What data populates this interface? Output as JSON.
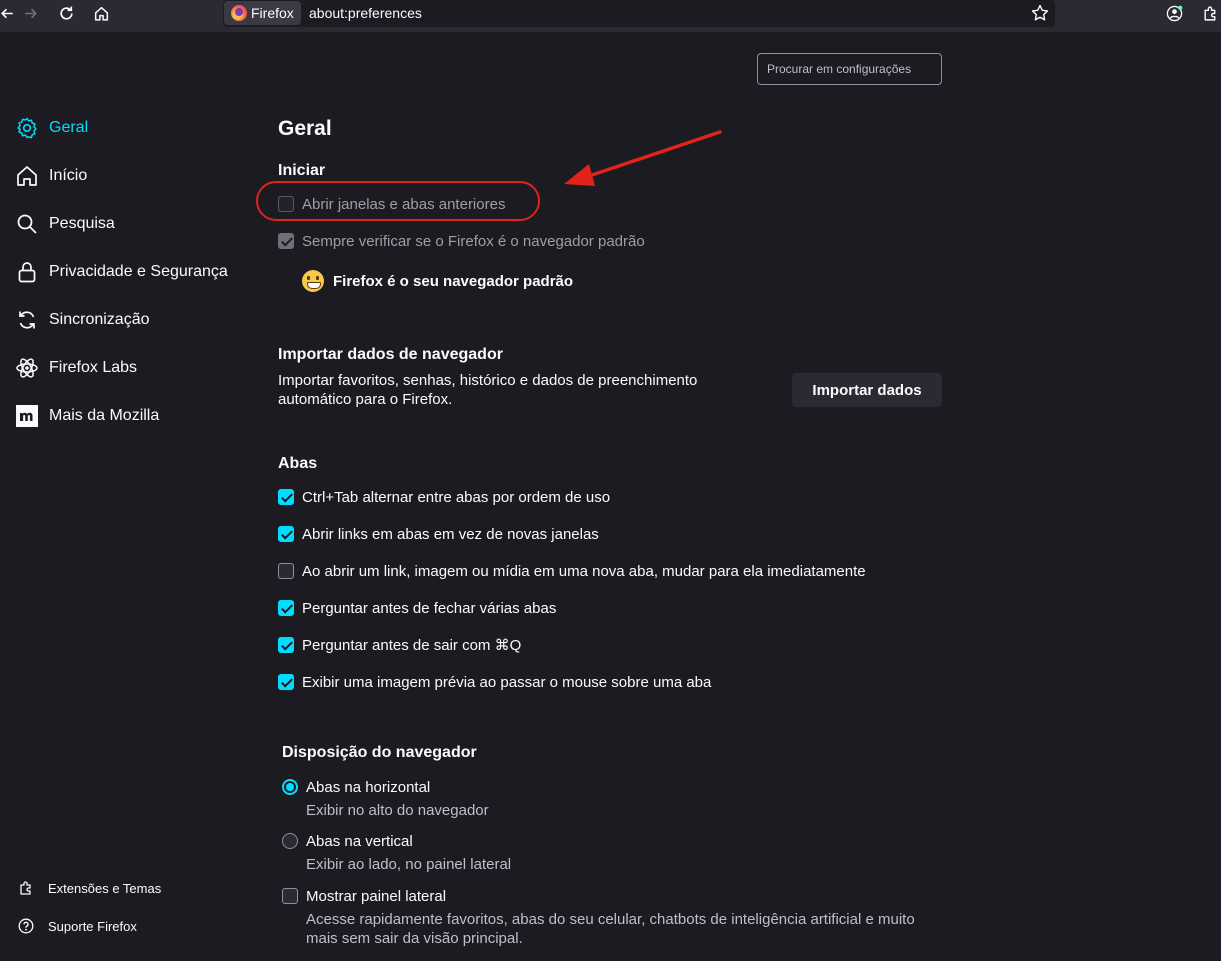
{
  "browser": {
    "identity_label": "Firefox",
    "url": "about:preferences"
  },
  "search": {
    "placeholder": "Procurar em configurações"
  },
  "sidebar": {
    "items": [
      {
        "label": "Geral",
        "icon": "gear-icon",
        "active": true
      },
      {
        "label": "Início",
        "icon": "home-icon"
      },
      {
        "label": "Pesquisa",
        "icon": "search-icon"
      },
      {
        "label": "Privacidade e Segurança",
        "icon": "lock-icon"
      },
      {
        "label": "Sincronização",
        "icon": "sync-icon"
      },
      {
        "label": "Firefox Labs",
        "icon": "atom-icon"
      },
      {
        "label": "Mais da Mozilla",
        "icon": "mozilla-m-icon"
      }
    ],
    "footer": [
      {
        "label": "Extensões e Temas",
        "icon": "puzzle-icon"
      },
      {
        "label": "Suporte Firefox",
        "icon": "help-icon"
      }
    ]
  },
  "page": {
    "title": "Geral",
    "startup": {
      "heading": "Iniciar",
      "restore_session": {
        "label": "Abrir janelas e abas anteriores",
        "checked": false,
        "disabled": true
      },
      "check_default": {
        "label": "Sempre verificar se o Firefox é o navegador padrão",
        "checked": true,
        "disabled": true
      },
      "default_status": "Firefox é o seu navegador padrão"
    },
    "import": {
      "heading": "Importar dados de navegador",
      "desc_line1": "Importar favoritos, senhas, histórico e dados de preenchimento",
      "desc_line2": "automático para o Firefox.",
      "button": "Importar dados"
    },
    "tabs": {
      "heading": "Abas",
      "options": [
        {
          "label": "Ctrl+Tab alternar entre abas por ordem de uso",
          "checked": true
        },
        {
          "label": "Abrir links em abas em vez de novas janelas",
          "checked": true
        },
        {
          "label": "Ao abrir um link, imagem ou mídia em uma nova aba, mudar para ela imediatamente",
          "checked": false
        },
        {
          "label": "Perguntar antes de fechar várias abas",
          "checked": true
        },
        {
          "label": "Perguntar antes de sair com ⌘Q",
          "checked": true
        },
        {
          "label": "Exibir uma imagem prévia ao passar o mouse sobre uma aba",
          "checked": true
        }
      ]
    },
    "layout": {
      "heading": "Disposição do navegador",
      "horizontal": {
        "label": "Abas na horizontal",
        "desc": "Exibir no alto do navegador",
        "selected": true
      },
      "vertical": {
        "label": "Abas na vertical",
        "desc": "Exibir ao lado, no painel lateral",
        "selected": false
      },
      "sidebar": {
        "label": "Mostrar painel lateral",
        "checked": false,
        "desc_line1": "Acesse rapidamente favoritos, abas do seu celular, chatbots de inteligência artificial e muito",
        "desc_line2": "mais sem sair da visão principal."
      }
    }
  },
  "colors": {
    "accent": "#00ddff",
    "annotation": "#e0241b",
    "background": "#1c1b22"
  }
}
